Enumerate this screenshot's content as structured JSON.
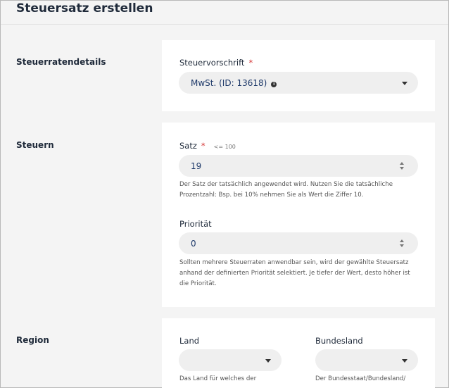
{
  "page": {
    "title": "Steuersatz erstellen"
  },
  "sections": {
    "details": {
      "title": "Steuerratendetails",
      "regulation_label": "Steuervorschrift",
      "required_mark": "*",
      "regulation_value": "MwSt. (ID: 13618)"
    },
    "taxes": {
      "title": "Steuern",
      "rate_label": "Satz",
      "required_mark": "*",
      "rate_constraint": "<= 100",
      "rate_value": "19",
      "rate_help": "Der Satz der tatsächlich angewendet wird. Nutzen Sie die tatsächliche Prozentzahl: Bsp. bei 10% nehmen Sie als Wert die Ziffer 10.",
      "priority_label": "Priorität",
      "priority_value": "0",
      "priority_help": "Sollten mehrere Steuerraten anwendbar sein, wird der gewählte Steuersatz anhand der definierten Priorität selektiert. Je tiefer der Wert, desto höher ist die Priorität."
    },
    "region": {
      "title": "Region",
      "country_label": "Land",
      "country_value": "",
      "country_help": "Das Land für welches der",
      "state_label": "Bundesland",
      "state_value": "",
      "state_help": "Der Bundesstaat/Bundesland/"
    }
  }
}
